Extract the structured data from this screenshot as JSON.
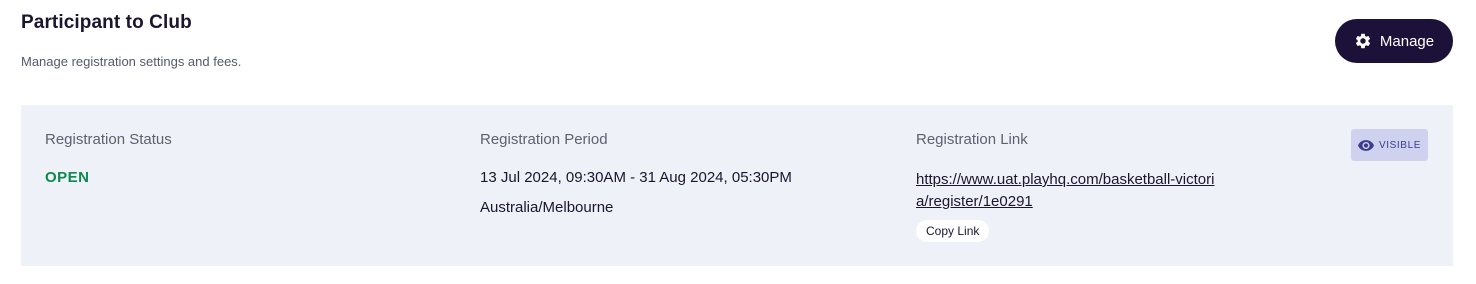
{
  "header": {
    "title": "Participant to Club",
    "subtitle": "Manage registration settings and fees.",
    "manage_button": {
      "label": "Manage",
      "icon": "gear-icon"
    }
  },
  "registration": {
    "status": {
      "label": "Registration Status",
      "value": "OPEN",
      "color": "#0b8a4b"
    },
    "period": {
      "label": "Registration Period",
      "range": "13 Jul 2024, 09:30AM - 31 Aug 2024, 05:30PM",
      "timezone": "Australia/Melbourne"
    },
    "link": {
      "label": "Registration Link",
      "url": "https://www.uat.playhq.com/basketball-victoria/register/1e0291",
      "copy_label": "Copy Link"
    },
    "visibility": {
      "label": "VISIBLE",
      "icon": "eye-icon"
    }
  },
  "colors": {
    "primary": "#1c1138",
    "panel_bg": "#eef1f7",
    "badge_bg": "#cfd2ef",
    "status_open": "#0b8a4b"
  }
}
